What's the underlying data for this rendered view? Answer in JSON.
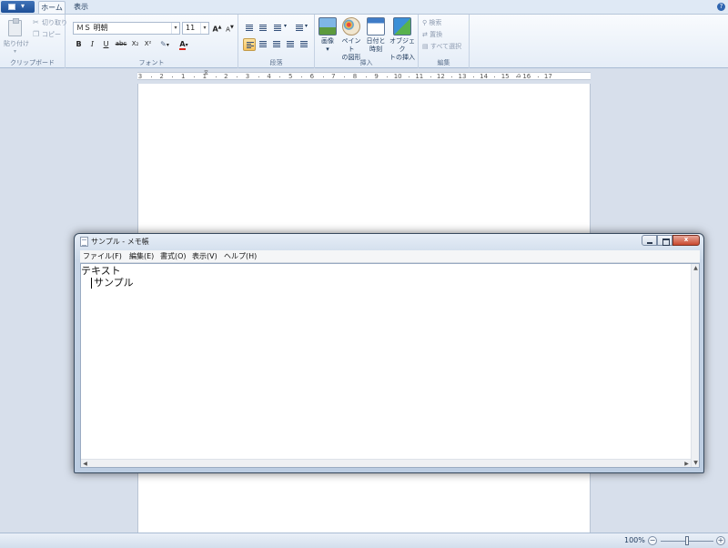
{
  "ribbon_tabs": {
    "home": "ホーム",
    "view": "表示",
    "help_glyph": "?"
  },
  "clipboard": {
    "paste_label": "貼り付け",
    "cut_label": "切り取り",
    "copy_label": "コピー",
    "group_label": "クリップボード"
  },
  "font": {
    "family_value": "ＭＳ 明朝",
    "size_value": "11",
    "grow_glyph": "A",
    "shrink_glyph": "A",
    "bold_glyph": "B",
    "italic_glyph": "I",
    "underline_glyph": "U",
    "strike_glyph": "abc",
    "subscript_glyph": "X₂",
    "superscript_glyph": "X²",
    "color_glyph": "A",
    "group_label": "フォント"
  },
  "paragraph": {
    "group_label": "段落"
  },
  "insert": {
    "picture_label": "画像",
    "paint_label_1": "ペイント",
    "paint_label_2": "の図形",
    "datetime_label_1": "日付と",
    "datetime_label_2": "時刻",
    "object_label_1": "オブジェク",
    "object_label_2": "トの挿入",
    "group_label": "挿入"
  },
  "editing": {
    "find_label": "検索",
    "replace_label": "置換",
    "select_all_label": "すべて選択",
    "group_label": "編集"
  },
  "ruler": {
    "numbers": [
      "3",
      "2",
      "1",
      "1",
      "2",
      "3",
      "4",
      "5",
      "6",
      "7",
      "8",
      "9",
      "10",
      "11",
      "12",
      "13",
      "14",
      "15",
      "16",
      "17"
    ]
  },
  "statusbar": {
    "zoom": "100%",
    "zoom_percent": 100,
    "zoom_out_glyph": "−",
    "zoom_in_glyph": "+"
  },
  "notepad": {
    "title": "サンプル - メモ帳",
    "menus": [
      "ファイル(F)",
      "編集(E)",
      "書式(O)",
      "表示(V)",
      "ヘルプ(H)"
    ],
    "text_line_1": "テキスト",
    "text_line_2": "サンプル",
    "close_glyph": "x"
  },
  "colors": {
    "accent": "#2f65b0",
    "workspace": "#d7dfeb",
    "active_button": "#f8c25c"
  }
}
